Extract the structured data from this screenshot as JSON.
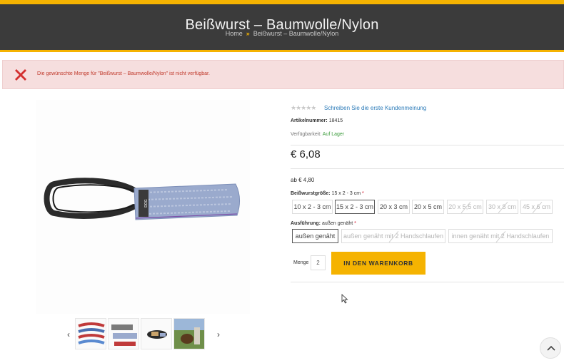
{
  "header": {
    "title": "Beißwurst – Baumwolle/Nylon",
    "breadcrumb": {
      "home": "Home",
      "separator": "»",
      "current": "Beißwurst – Baumwolle/Nylon"
    }
  },
  "error": {
    "message": "Die gewünschte Menge für \"Beißwurst – Baumwolle/Nylon\" ist nicht verfügbar.",
    "icon": "error-x-icon"
  },
  "product": {
    "stars": "★★★★★",
    "review_link": "Schreiben Sie die erste Kundenmeinung",
    "sku_label": "Artikelnummer:",
    "sku_value": "18415",
    "availability_label": "Verfügbarkeit:",
    "availability_value": "Auf Lager",
    "price": "€ 6,08",
    "from_price": "ab € 4,80"
  },
  "options": {
    "size": {
      "label": "Beißwurstgröße:",
      "selected": "15 x 2 - 3 cm",
      "required": "*",
      "values": [
        "10 x 2 - 3 cm",
        "15 x 2 - 3 cm",
        "20 x 3 cm",
        "20 x 5 cm",
        "20 x 5,5 cm",
        "30 x 8 cm",
        "45 x 6 cm"
      ]
    },
    "finish": {
      "label": "Ausführung:",
      "selected": "außen genäht",
      "required": "*",
      "values": [
        "außen genäht",
        "außen genäht mit 2 Handschlaufen",
        "innen genäht mit 2 Handschlaufen"
      ]
    }
  },
  "cart": {
    "qty_label": "Menge",
    "qty_value": "2",
    "button": "IN DEN WARENKORB"
  },
  "gallery": {
    "prev": "‹",
    "next": "›"
  },
  "colors": {
    "accent": "#f5b301",
    "header_bg": "#3b3b3b",
    "error_bg": "#f6dede",
    "error_text": "#c0392b",
    "link": "#2a7ab8",
    "in_stock": "#3a9b3a"
  }
}
